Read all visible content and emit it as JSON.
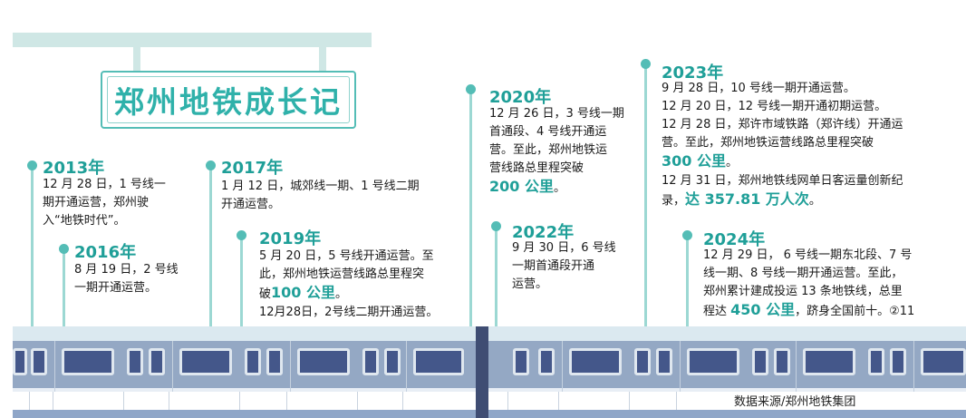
{
  "title": "郑州地铁成长记",
  "source": "数据来源/郑州地铁集团",
  "milestones": {
    "y2013": {
      "year": "2013年",
      "lines": [
        "12 月 28 日，1 号线一",
        "期开通运营，郑州驶",
        "入“地铁时代”。"
      ]
    },
    "y2016": {
      "year": "2016年",
      "lines": [
        "8 月 19 日，2 号线",
        "一期开通运营。"
      ]
    },
    "y2017": {
      "year": "2017年",
      "lines": [
        "1 月 12 日，城郊线一期、1 号线二期",
        "开通运营。"
      ]
    },
    "y2019": {
      "year": "2019年",
      "lines": [
        "5 月 20 日，5 号线开通运营。至",
        "此，郑州地铁运营线路总里程突"
      ],
      "pre": "破",
      "highlight": "100 公里",
      "post": "。",
      "extra": "12月28日，2号线二期开通运营。"
    },
    "y2020": {
      "year": "2020年",
      "lines": [
        "12 月 26 日，3 号线一期",
        "首通段、4 号线开通运",
        "营。至此，郑州地铁运",
        "营线路总里程突破"
      ],
      "highlight": "200 公里",
      "post": "。"
    },
    "y2022": {
      "year": "2022年",
      "lines": [
        "9 月 30 日，6 号线",
        "一期首通段开通",
        "运营。"
      ]
    },
    "y2023": {
      "year": "2023年",
      "lines": [
        "9 月 28 日，10 号线一期开通运营。",
        "12 月 20 日，12 号线一期开通初期运营。",
        "12 月 28 日，郑许市域铁路（郑许线）开通运",
        "营。至此，郑州地铁运营线路总里程突破"
      ],
      "highlight": "300 公里",
      "post": "。",
      "extra1": "12 月 31 日，郑州地铁线网单日客运量创新纪",
      "extra2_pre": "录，",
      "extra2_hl": "达 357.81 万人次",
      "extra2_post": "。"
    },
    "y2024": {
      "year": "2024年",
      "lines": [
        "12 月 29 日， 6 号线一期东北段、7 号",
        "线一期、8 号线一期开通运营。至此，",
        "郑州累计建成投运 13 条地铁线，总里"
      ],
      "pre": "程达 ",
      "highlight": "450 公里",
      "post": "，跻身全国前十。②11"
    }
  },
  "colors": {
    "accent": "#1f9f98",
    "train_body": "#94a8c4",
    "window": "#44578a"
  }
}
